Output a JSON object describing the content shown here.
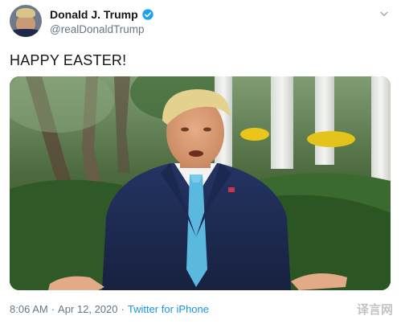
{
  "author": {
    "display_name": "Donald J. Trump",
    "handle": "@realDonaldTrump",
    "verified_icon": "verified-badge-icon"
  },
  "tweet": {
    "text": "HAPPY EASTER!"
  },
  "media": {
    "type": "video-still",
    "description_icon": "media-image"
  },
  "meta": {
    "time": "8:06 AM",
    "separator1": "·",
    "date": "Apr 12, 2020",
    "separator2": "·",
    "source": "Twitter for iPhone"
  },
  "watermark": {
    "text": "译言网"
  },
  "colors": {
    "link": "#1b95e0",
    "muted": "#657786",
    "text": "#14171a",
    "verified": "#1da1f2"
  }
}
